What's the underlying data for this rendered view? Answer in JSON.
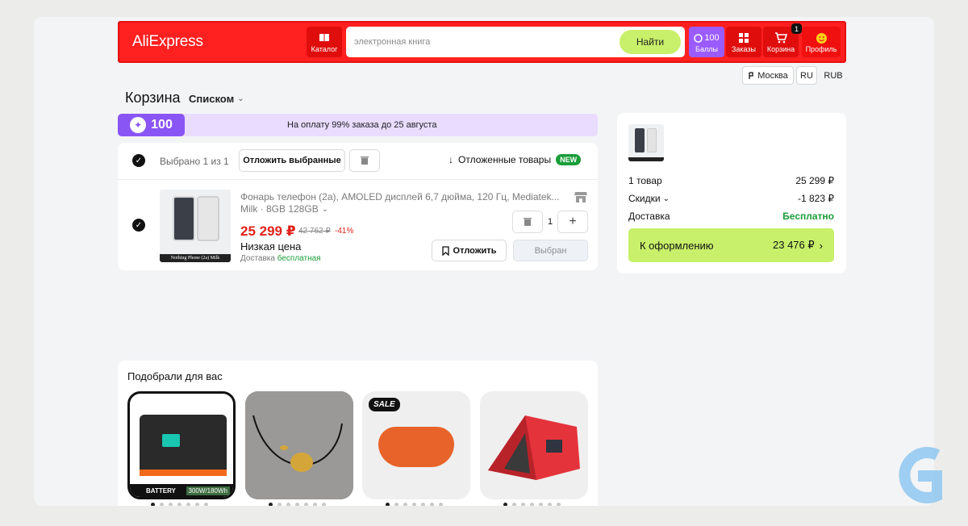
{
  "header": {
    "logo": "AliExpress",
    "catalog_label": "Каталог",
    "search_placeholder": "электронная книга",
    "search_button": "Найти",
    "points_value": "100",
    "points_label": "Баллы",
    "orders_label": "Заказы",
    "cart_label": "Корзина",
    "cart_count": "1",
    "profile_label": "Профиль",
    "city": "Москва",
    "language": "RU",
    "currency": "RUB"
  },
  "cart": {
    "title": "Корзина",
    "view_mode": "Списком",
    "promo_points": "100",
    "promo_text": "На оплату 99% заказа до 25 августа",
    "selected_text": "Выбрано 1 из 1",
    "postpone_selected": "Отложить выбранные",
    "postponed_items": "Отложенные товары",
    "new_badge": "NEW"
  },
  "product": {
    "title": "Фонарь телефон (2а), AMOLED дисплей 6,7 дюйма, 120 Гц, Mediatek...",
    "variant": "Milk · 8GB 128GB",
    "image_caption": "Nothing Phone (2a) Milk",
    "price": "25 299 ₽",
    "old_price": "42 762 ₽",
    "discount": "-41%",
    "low_price": "Низкая цена",
    "delivery_label": "Доставка",
    "delivery_free": "бесплатная",
    "quantity": "1",
    "postpone_button": "Отложить",
    "selected_button": "Выбран"
  },
  "summary": {
    "items_label": "1 товар",
    "items_value": "25 299 ₽",
    "discounts_label": "Скидки",
    "discounts_value": "-1 823 ₽",
    "delivery_label": "Доставка",
    "delivery_value": "Бесплатно",
    "checkout_label": "К оформлению",
    "checkout_total": "23 476 ₽"
  },
  "recommendations": {
    "title": "Подобрали для вас",
    "items": [
      {
        "caption": "BATTERY",
        "power": "300W/180Wh"
      },
      {
        "caption": ""
      },
      {
        "caption": "SALE"
      },
      {
        "caption": ""
      }
    ]
  },
  "colors": {
    "brand_red": "#ff2020",
    "accent_green": "#c8f06a",
    "points_purple": "#8a55f5",
    "price_red": "#e0221a",
    "free_green": "#1a9d3a"
  }
}
